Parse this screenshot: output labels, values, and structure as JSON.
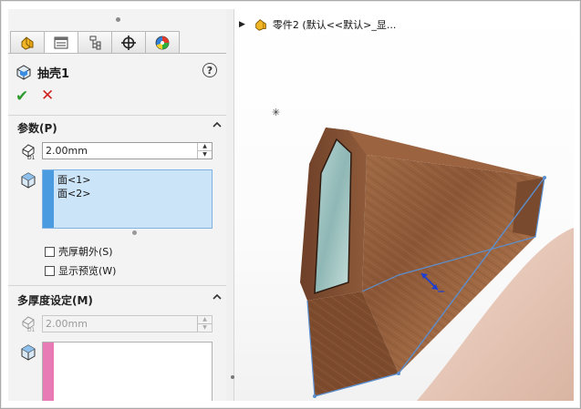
{
  "tabs": [
    {
      "name": "feature-manager-tab",
      "icon": "feature-tree-icon"
    },
    {
      "name": "property-manager-tab",
      "icon": "property-list-icon"
    },
    {
      "name": "configuration-manager-tab",
      "icon": "configuration-icon"
    },
    {
      "name": "dimxpert-tab",
      "icon": "crosshair-icon"
    },
    {
      "name": "display-manager-tab",
      "icon": "appearance-pie-icon"
    }
  ],
  "feature": {
    "title": "抽壳1",
    "help": "?"
  },
  "actions": {
    "ok": "✔",
    "cancel": "✕"
  },
  "parameters": {
    "header": "参数(P)",
    "thickness": "2.00mm",
    "faces": [
      "面<1>",
      "面<2>"
    ],
    "shell_outward": "壳厚朝外(S)",
    "show_preview": "显示预览(W)"
  },
  "multi_thickness": {
    "header": "多厚度设定(M)",
    "thickness": "2.00mm"
  },
  "tree": {
    "label": "零件2 (默认<<默认>_显..."
  },
  "colors": {
    "accent_blue": "#4a9be0",
    "list_bg": "#cce4f7",
    "pink_bar": "#e87ab5",
    "wood": "#8a5a3c"
  }
}
